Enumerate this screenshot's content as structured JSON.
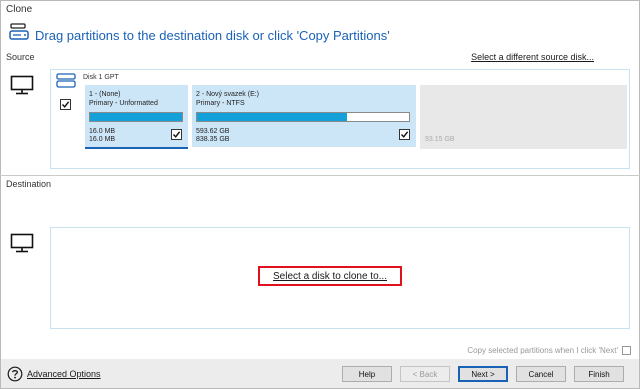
{
  "window": {
    "title": "Clone"
  },
  "header": {
    "title": "Drag partitions to the destination disk or click 'Copy Partitions'"
  },
  "source": {
    "label": "Source",
    "select_link": "Select a different source disk...",
    "disk_name": "Disk 1 GPT",
    "partitions": [
      {
        "title": "1 -  (None)",
        "type": "Primary - Unformatted",
        "used": "16.0 MB",
        "total": "16.0 MB",
        "fill_fraction": 1.0,
        "checked": true
      },
      {
        "title": "2 - Nový svazek (E:)",
        "type": "Primary - NTFS",
        "used": "593.62 GB",
        "total": "838.35 GB",
        "fill_fraction": 0.708,
        "checked": true
      }
    ],
    "unallocated": {
      "size": "93.15 GB"
    }
  },
  "destination": {
    "label": "Destination",
    "select_link": "Select a disk to clone to..."
  },
  "options": {
    "copy_label": "Copy selected partitions when I click 'Next'",
    "copy_checked": false
  },
  "footer": {
    "advanced_options": "Advanced Options",
    "help": "Help",
    "back": "< Back",
    "next": "Next >",
    "cancel": "Cancel",
    "finish": "Finish"
  },
  "colors": {
    "accent": "#1a62b6",
    "bar_fill": "#14a0d8",
    "partition_bg": "#cde6f7",
    "highlight": "#e0101c"
  },
  "icons": {
    "header": "disk-clone-icon",
    "monitor": "monitor-icon",
    "disk": "disk-icon",
    "advanced": "question-icon"
  }
}
